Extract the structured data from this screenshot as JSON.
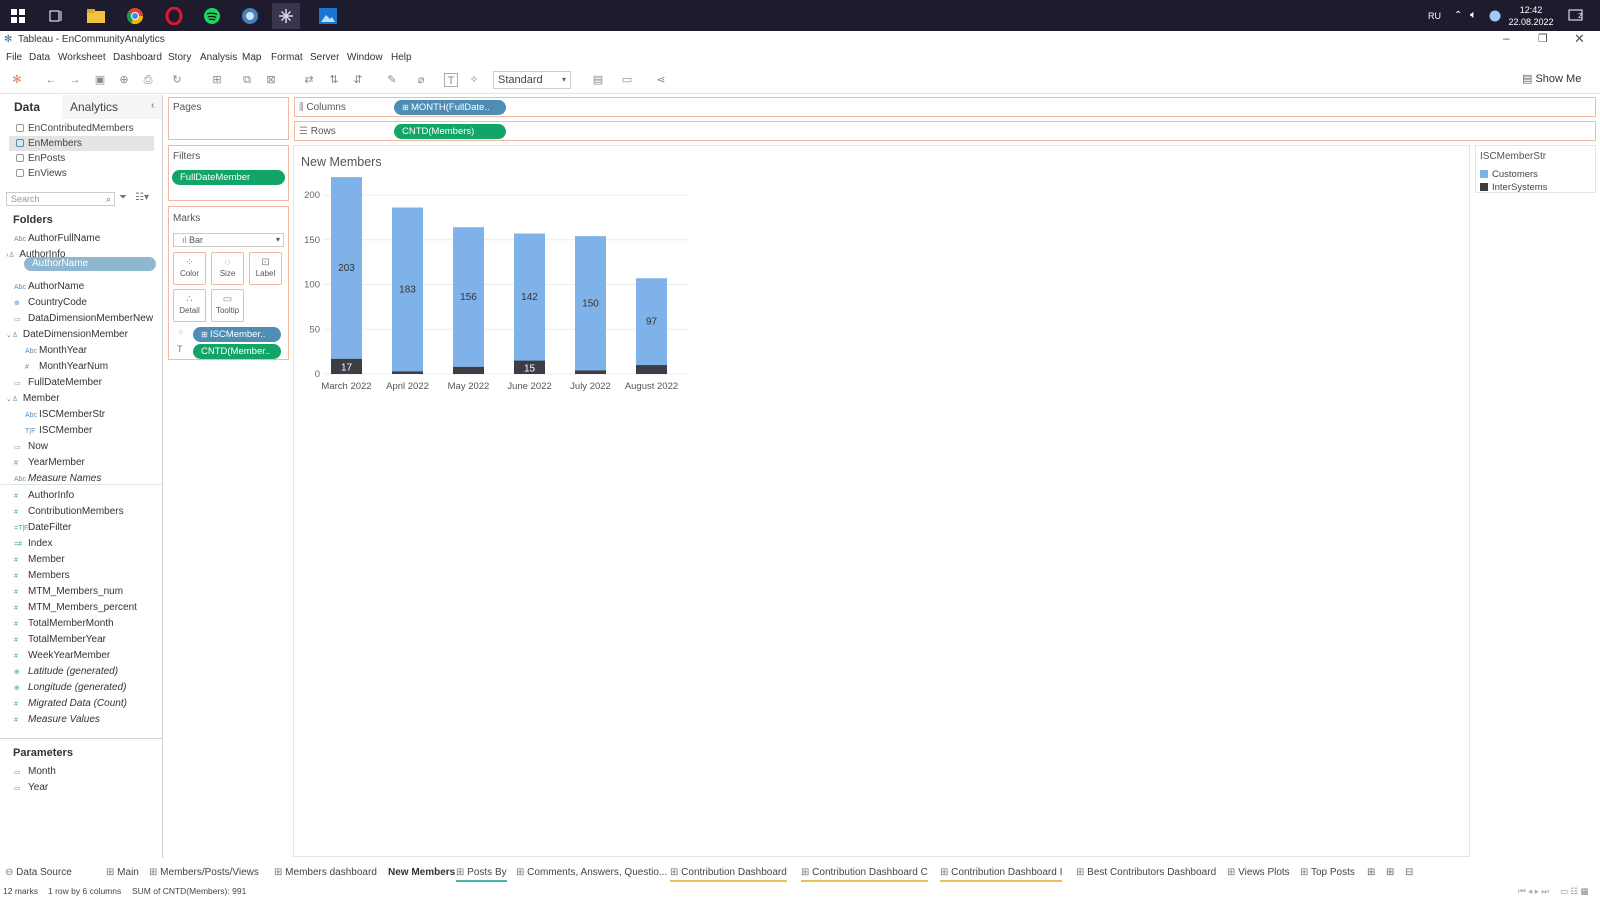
{
  "taskbar": {
    "lang": "RU",
    "time": "12:42",
    "date": "22.08.2022",
    "notifications": "2"
  },
  "window": {
    "title": "Tableau - EnCommunityAnalytics"
  },
  "menu": [
    "File",
    "Data",
    "Worksheet",
    "Dashboard",
    "Story",
    "Analysis",
    "Map",
    "Format",
    "Server",
    "Window",
    "Help"
  ],
  "toolbar": {
    "fit": "Standard",
    "show_me": "Show Me"
  },
  "data_pane": {
    "tab_data": "Data",
    "tab_analytics": "Analytics",
    "sources": [
      "EnContributedMembers",
      "EnMembers",
      "EnPosts",
      "EnViews"
    ],
    "search_placeholder": "Search",
    "folders_title": "Folders",
    "dragging": "AuthorName",
    "dimensions": [
      {
        "label": "AuthorFullName",
        "icon": "Abc"
      },
      {
        "label": "AuthorInfo",
        "icon": "tree"
      },
      {
        "label": "AuthorName",
        "icon": "Abc"
      },
      {
        "label": "CountryCode",
        "icon": "geo"
      },
      {
        "label": "DataDimensionMemberNew",
        "icon": "date"
      },
      {
        "label": "DateDimensionMember",
        "icon": "tree"
      },
      {
        "label": "MonthYear",
        "icon": "Abc"
      },
      {
        "label": "MonthYearNum",
        "icon": "#"
      },
      {
        "label": "FullDateMember",
        "icon": "date"
      },
      {
        "label": "Member",
        "icon": "tree"
      },
      {
        "label": "ISCMemberStr",
        "icon": "Abc"
      },
      {
        "label": "ISCMember",
        "icon": "tf"
      },
      {
        "label": "Now",
        "icon": "date"
      },
      {
        "label": "YearMember",
        "icon": "#"
      },
      {
        "label": "Measure Names",
        "icon": "Abc"
      }
    ],
    "measures": [
      {
        "label": "AuthorInfo"
      },
      {
        "label": "ContributionMembers"
      },
      {
        "label": "DateFilter"
      },
      {
        "label": "Index"
      },
      {
        "label": "Member"
      },
      {
        "label": "Members"
      },
      {
        "label": "MTM_Members_num"
      },
      {
        "label": "MTM_Members_percent"
      },
      {
        "label": "TotalMemberMonth"
      },
      {
        "label": "TotalMemberYear"
      },
      {
        "label": "WeekYearMember"
      },
      {
        "label": "Latitude (generated)"
      },
      {
        "label": "Longitude (generated)"
      },
      {
        "label": "Migrated Data (Count)"
      },
      {
        "label": "Measure Values"
      }
    ],
    "parameters_title": "Parameters",
    "parameters": [
      "Month",
      "Year"
    ]
  },
  "shelves": {
    "pages": "Pages",
    "filters": "Filters",
    "filter_pill": "FullDateMember",
    "marks": "Marks",
    "mark_type": "Bar",
    "mark_buttons": [
      "Color",
      "Size",
      "Label",
      "Detail",
      "Tooltip"
    ],
    "marks_pill_color": "ISCMember..",
    "marks_pill_label": "CNTD(Member..",
    "columns": "Columns",
    "columns_pill": "MONTH(FullDate..",
    "rows": "Rows",
    "rows_pill": "CNTD(Members)"
  },
  "legend": {
    "title": "ISCMemberStr",
    "items": [
      {
        "label": "Customers",
        "color": "#7fb2e8"
      },
      {
        "label": "InterSystems",
        "color": "#3d3d45"
      }
    ]
  },
  "chart_data": {
    "type": "bar",
    "title": "New Members",
    "categories": [
      "March 2022",
      "April 2022",
      "May 2022",
      "June 2022",
      "July 2022",
      "August 2022"
    ],
    "series": [
      {
        "name": "Customers",
        "values": [
          203,
          183,
          156,
          142,
          150,
          97
        ]
      },
      {
        "name": "InterSystems",
        "values": [
          17,
          3,
          8,
          15,
          4,
          10
        ]
      }
    ],
    "data_labels_customers": [
      "203",
      "183",
      "156",
      "142",
      "150",
      "97"
    ],
    "data_labels_intersystems": [
      "17",
      "",
      "",
      "15",
      "",
      ""
    ],
    "yticks": [
      0,
      50,
      100,
      150,
      200
    ],
    "ylim": [
      0,
      220
    ],
    "stacked": true,
    "grid": true
  },
  "sheet_tabs": [
    "Data Source",
    "Main",
    "Members/Posts/Views",
    "Members dashboard",
    "New Members",
    "Posts By",
    "Comments, Answers, Questio...",
    "Contribution Dashboard",
    "Contribution Dashboard C",
    "Contribution Dashboard I",
    "Best Contributors Dashboard",
    "Views Plots",
    "Top Posts"
  ],
  "status": {
    "marks": "12 marks",
    "rows_cols": "1 row by 6 columns",
    "sum": "SUM of CNTD(Members): 991"
  }
}
